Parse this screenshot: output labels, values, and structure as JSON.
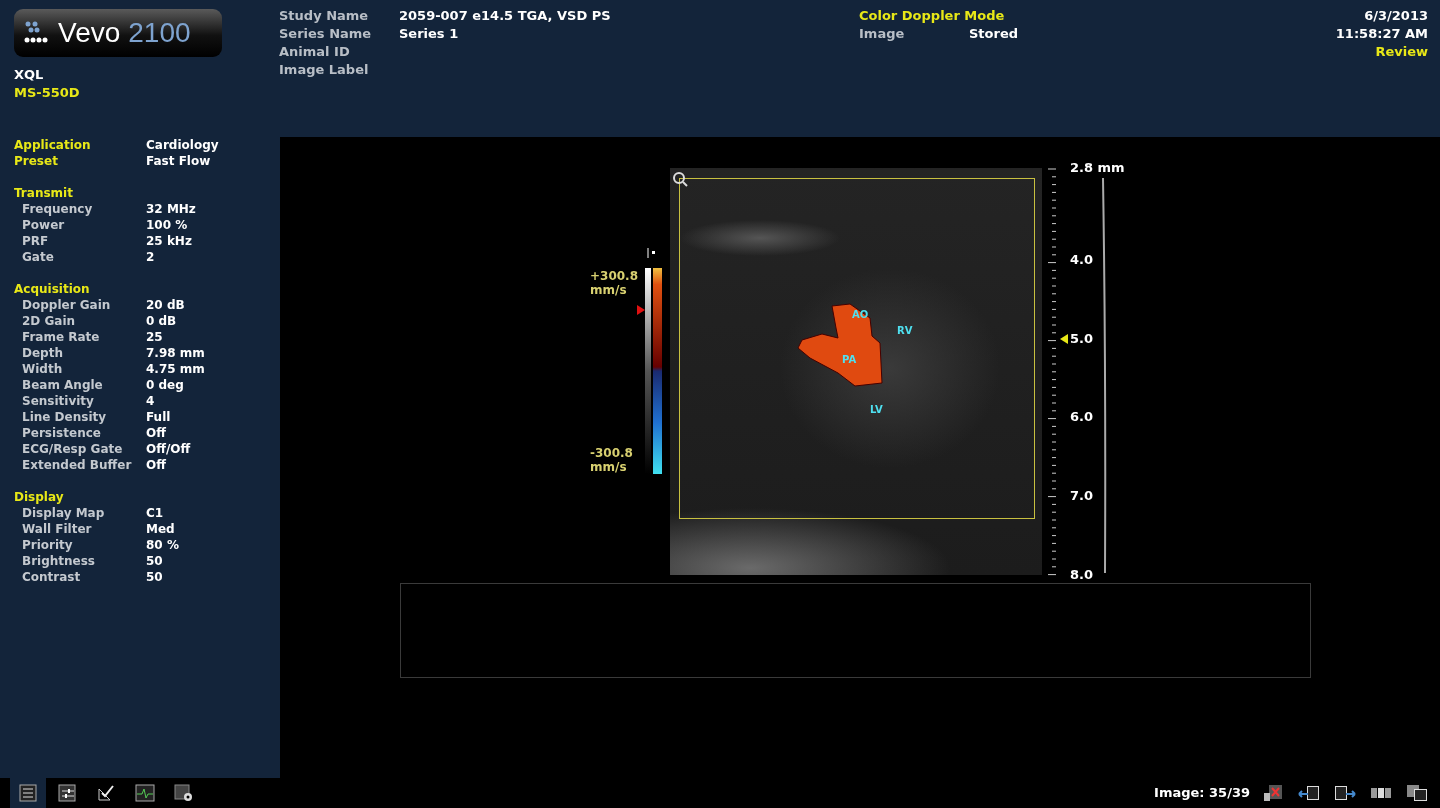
{
  "header": {
    "logo": {
      "brand": "Vevo",
      "model": "2100"
    },
    "system": "XQL",
    "transducer": "MS-550D",
    "study_fields": [
      {
        "label": "Study Name",
        "value": "2059-007 e14.5 TGA, VSD PS"
      },
      {
        "label": "Series Name",
        "value": "Series 1"
      },
      {
        "label": "Animal ID"
      },
      {
        "label": "Image Label"
      }
    ],
    "mode": "Color Doppler Mode",
    "image_status": {
      "label": "Image",
      "value": "Stored"
    },
    "date": "6/3/2013",
    "time": "11:58:27 AM",
    "state": "Review"
  },
  "sidebar": {
    "top": [
      {
        "label": "Application",
        "value": "Cardiology"
      },
      {
        "label": "Preset",
        "value": "Fast Flow"
      }
    ],
    "sections": [
      {
        "title": "Transmit",
        "rows": [
          {
            "label": "Frequency",
            "value": "32 MHz"
          },
          {
            "label": "Power",
            "value": "100 %"
          },
          {
            "label": "PRF",
            "value": "25 kHz"
          },
          {
            "label": "Gate",
            "value": "2"
          }
        ]
      },
      {
        "title": "Acquisition",
        "rows": [
          {
            "label": "Doppler Gain",
            "value": "20 dB"
          },
          {
            "label": "2D Gain",
            "value": "0 dB"
          },
          {
            "label": "Frame Rate",
            "value": "25"
          },
          {
            "label": "Depth",
            "value": "7.98 mm"
          },
          {
            "label": "Width",
            "value": "4.75 mm"
          },
          {
            "label": "Beam Angle",
            "value": "0 deg"
          },
          {
            "label": "Sensitivity",
            "value": "4"
          },
          {
            "label": "Line Density",
            "value": "Full"
          },
          {
            "label": "Persistence",
            "value": "Off"
          },
          {
            "label": "ECG/Resp Gate",
            "value": "Off/Off"
          },
          {
            "label": "Extended Buffer",
            "value": "Off"
          }
        ]
      },
      {
        "title": "Display",
        "rows": [
          {
            "label": "Display Map",
            "value": "C1"
          },
          {
            "label": "Wall Filter",
            "value": "Med"
          },
          {
            "label": "Priority",
            "value": "80 %"
          },
          {
            "label": "Brightness",
            "value": "50"
          },
          {
            "label": "Contrast",
            "value": "50"
          }
        ]
      }
    ]
  },
  "viewer": {
    "color_scale": {
      "max": "+300.8 mm/s",
      "min": "-300.8 mm/s"
    },
    "labels": [
      {
        "text": "AO"
      },
      {
        "text": "RV"
      },
      {
        "text": "PA"
      },
      {
        "text": "LV"
      }
    ],
    "depth_scale": [
      {
        "text": "2.8 mm",
        "focus": false
      },
      {
        "text": "4.0",
        "focus": false
      },
      {
        "text": "5.0",
        "focus": true
      },
      {
        "text": "6.0",
        "focus": false
      },
      {
        "text": "7.0",
        "focus": false
      },
      {
        "text": "8.0",
        "focus": false
      }
    ]
  },
  "toolbar": [
    {
      "kind": "list",
      "selected": true
    },
    {
      "kind": "sliders",
      "selected": false
    },
    {
      "kind": "measure",
      "selected": false
    },
    {
      "kind": "ecg",
      "selected": false
    },
    {
      "kind": "settings",
      "selected": false
    }
  ],
  "image_counter": "Image: 35/39",
  "image_tools": [
    {
      "kind": "delete"
    },
    {
      "kind": "previous"
    },
    {
      "kind": "next"
    },
    {
      "kind": "filmstrip"
    },
    {
      "kind": "compare"
    }
  ]
}
